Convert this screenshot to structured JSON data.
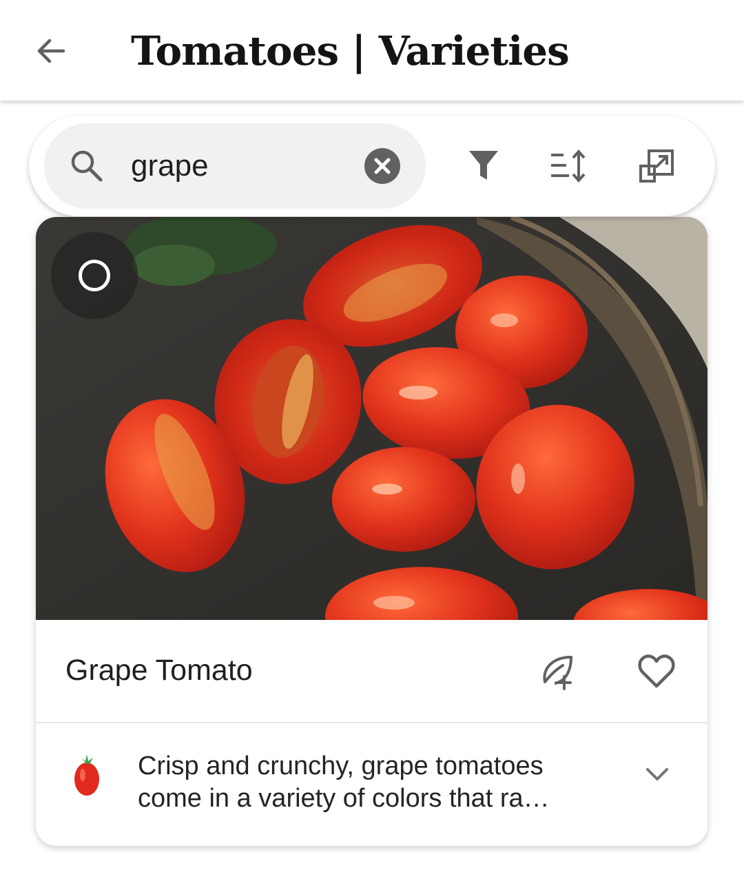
{
  "app_bar": {
    "title": "Tomatoes | Varieties",
    "back_icon": "arrow-back-icon"
  },
  "search": {
    "value": "grape",
    "search_icon": "search-icon",
    "clear_icon": "close-circle-icon"
  },
  "toolbar": {
    "filter_icon": "filter-icon",
    "sort_icon": "sort-icon",
    "expand_icon": "open-in-new-icon"
  },
  "card": {
    "title": "Grape Tomato",
    "description": "Crisp and crunchy, grape tomatoes come in a variety of colors that ra…",
    "image_subject": "grape tomatoes on a dark plate",
    "select_icon": "circle-outline-icon",
    "add_icon": "leaf-add-icon",
    "favorite_icon": "heart-outline-icon",
    "emoji_icon": "tomato-icon",
    "expand_icon": "chevron-down-icon"
  },
  "colors": {
    "icon_gray": "#616161",
    "title_black": "#141414",
    "search_bg": "#f1f1f1",
    "tomato_red": "#e0311b",
    "plate_dark": "#2f2d2a"
  }
}
